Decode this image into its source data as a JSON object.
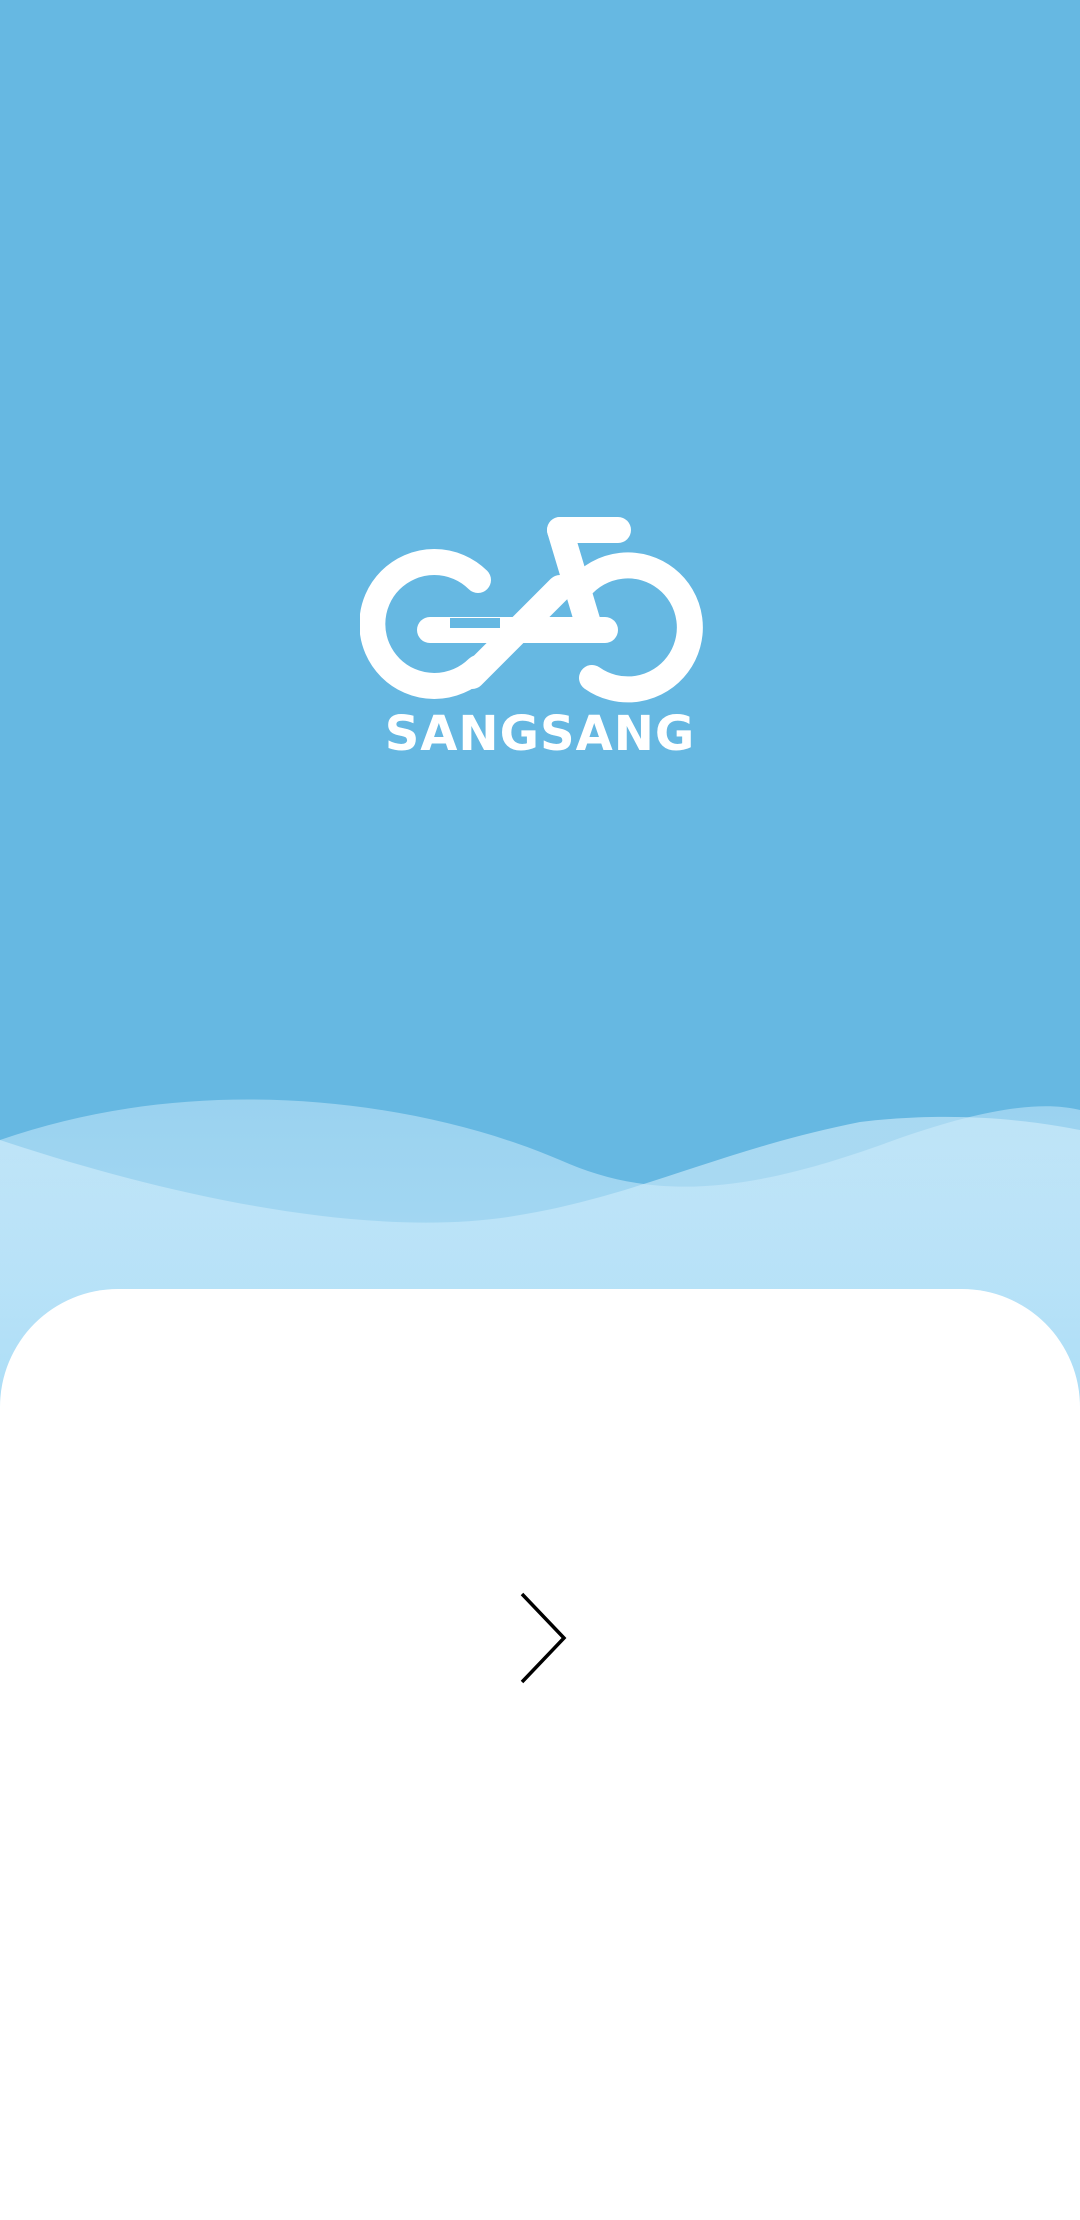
{
  "app": {
    "brand_name": "SANGSANG",
    "logo_icon": "bicycle-infinity-logo"
  },
  "colors": {
    "background": "#66b8e2",
    "wave_light": "#a8dcf6",
    "card": "#ffffff",
    "logo": "#ffffff",
    "chevron": "#000000"
  },
  "navigation": {
    "next_icon": "chevron-right-icon"
  }
}
